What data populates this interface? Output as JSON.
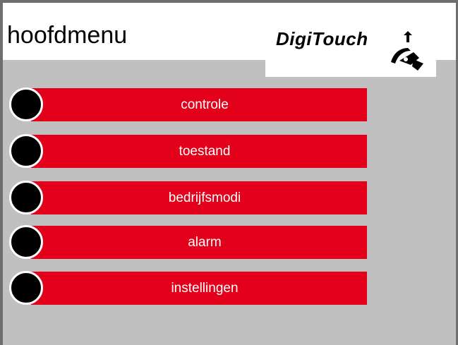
{
  "header": {
    "title": "hoofdmenu",
    "logo_text": "DigiTouch"
  },
  "menu": {
    "items": [
      {
        "label": "controle"
      },
      {
        "label": "toestand"
      },
      {
        "label": "bedrijfsmodi"
      },
      {
        "label": "alarm"
      },
      {
        "label": "instellingen"
      }
    ]
  },
  "colors": {
    "button": "#e2001a",
    "background": "#c0c0c0",
    "border": "#6e6e6e"
  },
  "icons": {
    "logo": "digitouch-hand-icon",
    "menu_item": "round-button-icon"
  }
}
